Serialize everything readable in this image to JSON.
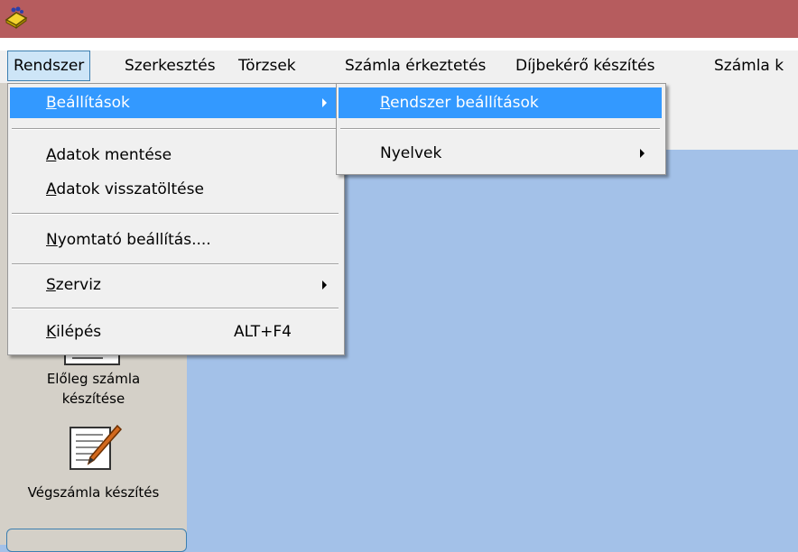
{
  "menubar": {
    "items": [
      {
        "label": "Rendszer"
      },
      {
        "label": "Szerkesztés"
      },
      {
        "label": "Törzsek"
      },
      {
        "label": "Számla érkeztetés"
      },
      {
        "label": "Díjbekérő készítés"
      },
      {
        "label": "Számla k"
      }
    ]
  },
  "rendszer_menu": {
    "beallitasok": {
      "first": "B",
      "rest": "eállítások"
    },
    "adatok_mentese": {
      "first": "A",
      "rest": "datok mentése"
    },
    "adatok_visszatoltese": {
      "first": "A",
      "rest": "datok visszatöltése"
    },
    "nyomtato": {
      "first": "N",
      "rest": "yomtató beállítás...."
    },
    "szerviz": {
      "first": "S",
      "rest": "zerviz"
    },
    "kilepes": {
      "first": "K",
      "rest": "ilépés",
      "shortcut": "ALT+F4"
    }
  },
  "beallitasok_submenu": {
    "rendszer_beallitasok": {
      "first": "R",
      "rest": "endszer beállítások"
    },
    "nyelvek": "Nyelvek"
  },
  "left_panel": {
    "tool1_line1": "Előleg számla",
    "tool1_line2": "készítése",
    "tool2": "Végszámla készítés"
  },
  "colors": {
    "titlebar": "#b65c5e",
    "highlight": "#3399ff",
    "desktop": "#a3c1e8"
  }
}
